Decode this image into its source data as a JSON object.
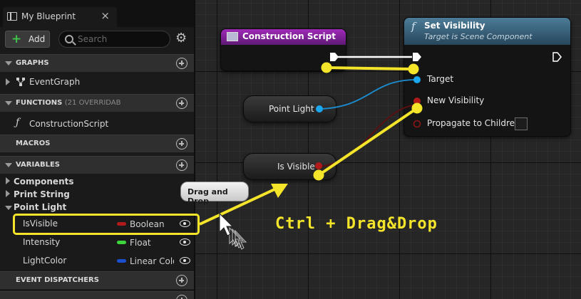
{
  "panel": {
    "tab_title": "My Blueprint",
    "tab_close": "×",
    "add_label": "Add",
    "add_plus": "+",
    "search_placeholder": "Search",
    "gear_glyph": "⚙"
  },
  "sections": {
    "graphs": "GRAPHS",
    "functions": "FUNCTIONS",
    "functions_extra": "(21 OVERRIDAB",
    "macros": "MACROS",
    "variables": "VARIABLES",
    "event_dispatchers": "EVENT DISPATCHERS"
  },
  "graph_items": [
    {
      "label": "EventGraph"
    }
  ],
  "function_items": [
    {
      "label": "ConstructionScript"
    }
  ],
  "variable_categories": {
    "components": "Components",
    "print_string": "Print String",
    "point_light": "Point Light"
  },
  "variables": [
    {
      "name": "IsVisible",
      "type": "Boolean",
      "color": "#b01a1a"
    },
    {
      "name": "Intensity",
      "type": "Float",
      "color": "#3cd63c"
    },
    {
      "name": "LightColor",
      "type": "Linear Colo",
      "color": "#1a4fd0"
    }
  ],
  "graph": {
    "construction_node_title": "Construction Script",
    "set_visibility": {
      "title": "Set Visibility",
      "subtitle": "Target is Scene Component",
      "func_glyph": "f",
      "pins": [
        "Target",
        "New Visibility",
        "Propagate to Children"
      ]
    },
    "point_light_node": "Point Light",
    "is_visible_node": "Is Visible",
    "tooltip": "Drag and Drop",
    "annotation": "Ctrl + Drag&Drop"
  },
  "colors": {
    "highlight": "#f5e52a",
    "construction_header": "#9f2ab8",
    "function_header": "#4d7c98",
    "object_pin": "#1aa7ee",
    "bool_pin": "#b01a1a"
  }
}
